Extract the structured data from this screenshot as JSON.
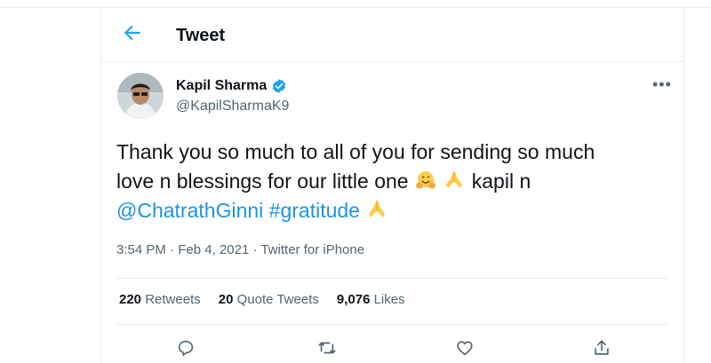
{
  "header": {
    "title": "Tweet",
    "back_icon": "arrow-left-icon"
  },
  "author": {
    "name": "Kapil Sharma",
    "handle": "@KapilSharmaK9",
    "verified_icon": "verified-badge-icon",
    "avatar_icon": "profile-photo"
  },
  "tweet": {
    "line1": "Thank you so much to all of you for sending so much",
    "line2_text": "love n blessings for our little one",
    "line2_suffix": "kapil n",
    "mention": "@ChatrathGinni",
    "hashtag": "#gratitude",
    "emojis": [
      "hugging-face-emoji",
      "folded-hands-emoji",
      "folded-hands-emoji"
    ]
  },
  "meta": {
    "time": "3:54 PM",
    "dot": "·",
    "date": "Feb 4, 2021",
    "source": "Twitter for iPhone"
  },
  "stats": {
    "retweets_count": "220",
    "retweets_label": "Retweets",
    "quotes_count": "20",
    "quotes_label": "Quote Tweets",
    "likes_count": "9,076",
    "likes_label": "Likes"
  },
  "actions": [
    "reply-icon",
    "retweet-icon",
    "like-icon",
    "share-icon"
  ],
  "colors": {
    "link": "#1b95e0",
    "accent": "#1da1f2",
    "secondary_text": "#536471",
    "border": "#e6ecf0"
  }
}
